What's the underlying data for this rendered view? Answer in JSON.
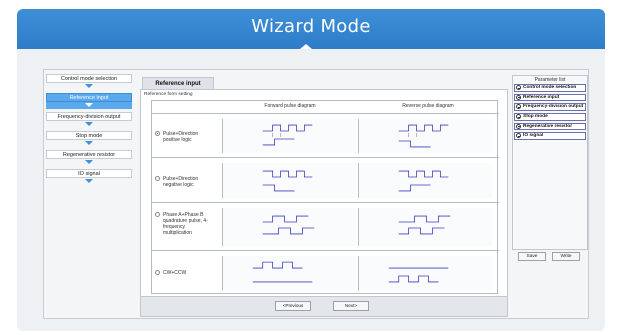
{
  "header": {
    "title": "Wizard Mode"
  },
  "steps": [
    {
      "label": "Control mode selection",
      "active": false
    },
    {
      "label": "Reference input",
      "active": true
    },
    {
      "label": "Frequency-division output",
      "active": false
    },
    {
      "label": "Stop mode",
      "active": false
    },
    {
      "label": "Regenerative resistor",
      "active": false
    },
    {
      "label": "IO signal",
      "active": false
    }
  ],
  "tab": {
    "label": "Reference input"
  },
  "form": {
    "section_label": "Reference form setting",
    "col_forward": "Forward pulse diagram",
    "col_reverse": "Reverse pulse diagram",
    "options": [
      {
        "label": "Pulse+Direction positive logic",
        "selected": true
      },
      {
        "label": "Pulse+Direction negative logic",
        "selected": false
      },
      {
        "label": "Phase A+Phase B quadrature pulse, 4-frequency multiplication",
        "selected": false
      },
      {
        "label": "CW+CCW",
        "selected": false
      }
    ]
  },
  "nav": {
    "previous": "<Previous",
    "next": "Next>"
  },
  "parameter_list": {
    "title": "Parameter list",
    "items": [
      "Control mode selection",
      "Reference input",
      "Frequency-division output",
      "Stop mode",
      "Regenerative resistor",
      "IO signal"
    ],
    "save": "Save",
    "write": "Write"
  },
  "colors": {
    "header": "#2d7cc8",
    "active_step": "#5aa9ec",
    "waveform": "#3a3fbf"
  }
}
